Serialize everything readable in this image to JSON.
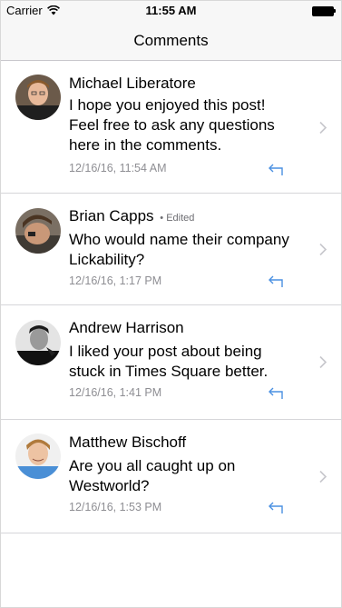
{
  "status": {
    "carrier": "Carrier",
    "time": "11:55 AM"
  },
  "nav": {
    "title": "Comments"
  },
  "colors": {
    "accent": "#4a90e2",
    "secondary_text": "#8e8e93",
    "separator": "#d6d6d9"
  },
  "comments": [
    {
      "author": "Michael Liberatore",
      "edited": "",
      "body": "I hope you enjoyed this post! Feel free to ask any questions here in the comments.",
      "timestamp": "12/16/16, 11:54 AM",
      "avatar_icon": "avatar-photo"
    },
    {
      "author": "Brian Capps",
      "edited": "• Edited",
      "body": "Who would name their company Lickability?",
      "timestamp": "12/16/16, 1:17 PM",
      "avatar_icon": "avatar-photo"
    },
    {
      "author": "Andrew Harrison",
      "edited": "",
      "body": "I liked your post about being stuck in Times Square better.",
      "timestamp": "12/16/16, 1:41 PM",
      "avatar_icon": "avatar-photo"
    },
    {
      "author": "Matthew Bischoff",
      "edited": "",
      "body": "Are you all caught up on Westworld?",
      "timestamp": "12/16/16, 1:53 PM",
      "avatar_icon": "avatar-photo"
    }
  ]
}
